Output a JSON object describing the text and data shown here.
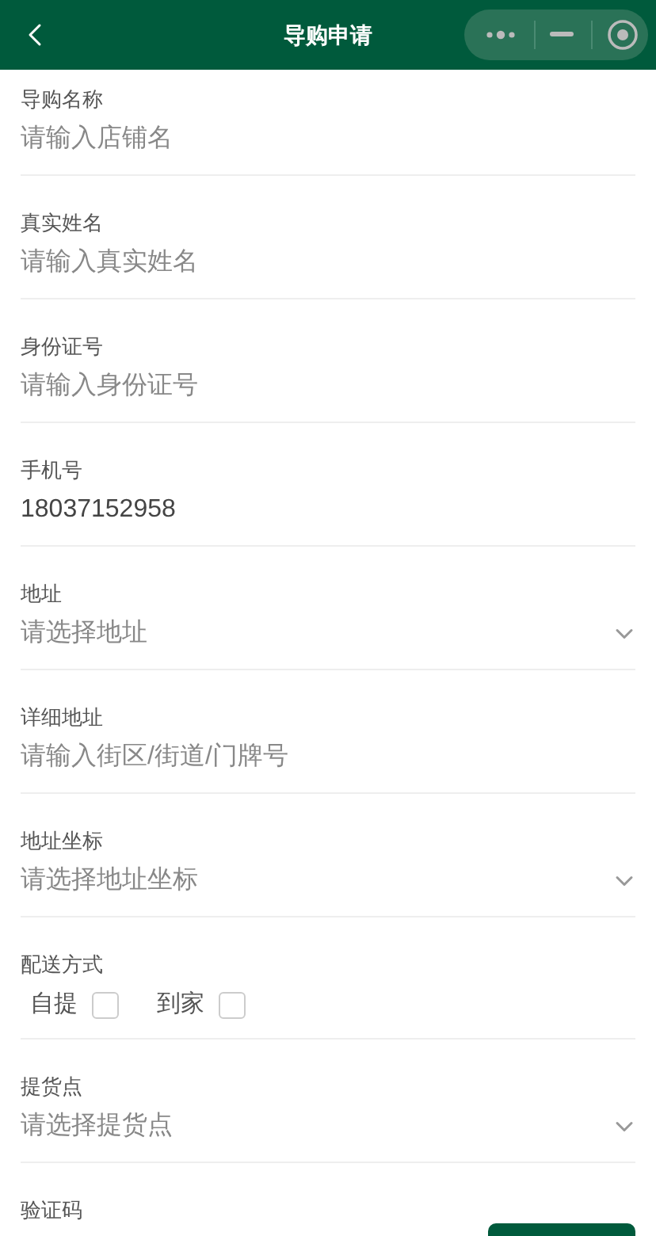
{
  "header": {
    "title": "导购申请"
  },
  "fields": [
    {
      "kind": "input",
      "label": "导购名称",
      "placeholder": "请输入店铺名"
    },
    {
      "kind": "input",
      "label": "真实姓名",
      "placeholder": "请输入真实姓名"
    },
    {
      "kind": "input",
      "label": "身份证号",
      "placeholder": "请输入身份证号"
    },
    {
      "kind": "input",
      "label": "手机号",
      "value": "18037152958"
    },
    {
      "kind": "select",
      "label": "地址",
      "placeholder": "请选择地址"
    },
    {
      "kind": "input",
      "label": "详细地址",
      "placeholder": "请输入街区/街道/门牌号"
    },
    {
      "kind": "select",
      "label": "地址坐标",
      "placeholder": "请选择地址坐标"
    },
    {
      "kind": "checkboxes",
      "label": "配送方式",
      "options": [
        {
          "label": "自提",
          "checked": false
        },
        {
          "label": "到家",
          "checked": false
        }
      ]
    },
    {
      "kind": "select",
      "label": "提货点",
      "placeholder": "请选择提货点"
    },
    {
      "kind": "code",
      "label": "验证码"
    }
  ]
}
